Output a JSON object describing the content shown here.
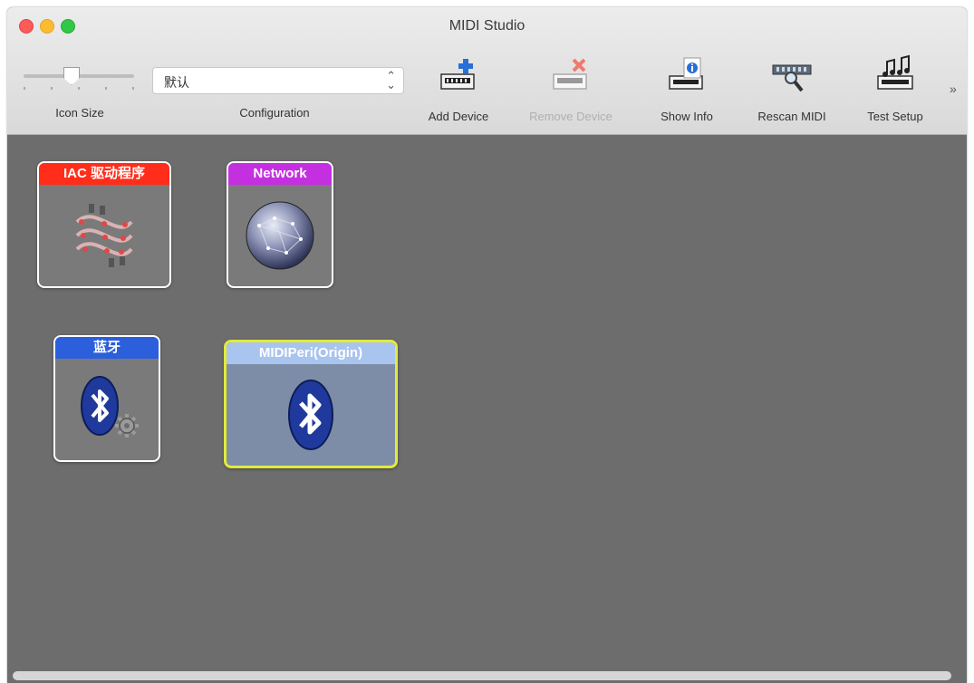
{
  "window": {
    "title": "MIDI Studio"
  },
  "toolbar": {
    "icon_size_label": "Icon Size",
    "configuration_label": "Configuration",
    "configuration_value": "默认",
    "buttons": [
      {
        "label": "Add Device",
        "icon": "add-device-icon",
        "enabled": true
      },
      {
        "label": "Remove Device",
        "icon": "remove-device-icon",
        "enabled": false
      },
      {
        "label": "Show Info",
        "icon": "show-info-icon",
        "enabled": true
      },
      {
        "label": "Rescan MIDI",
        "icon": "rescan-midi-icon",
        "enabled": true
      },
      {
        "label": "Test Setup",
        "icon": "test-setup-icon",
        "enabled": true
      }
    ],
    "overflow": "»"
  },
  "devices": [
    {
      "label": "IAC 驱动程序",
      "icon": "iac-cables-icon",
      "color": "#ff2d1a",
      "selected": false
    },
    {
      "label": "Network",
      "icon": "network-globe-icon",
      "color": "#c430e0",
      "selected": false
    },
    {
      "label": "蓝牙",
      "icon": "bluetooth-gear-icon",
      "color": "#2b5fdc",
      "selected": false
    },
    {
      "label": "MIDIPeri(Origin)",
      "icon": "bluetooth-icon",
      "color": "#a9c4ee",
      "selected": true
    }
  ],
  "colors": {
    "canvas": "#6d6d6d",
    "selection": "#e2ea3b"
  }
}
